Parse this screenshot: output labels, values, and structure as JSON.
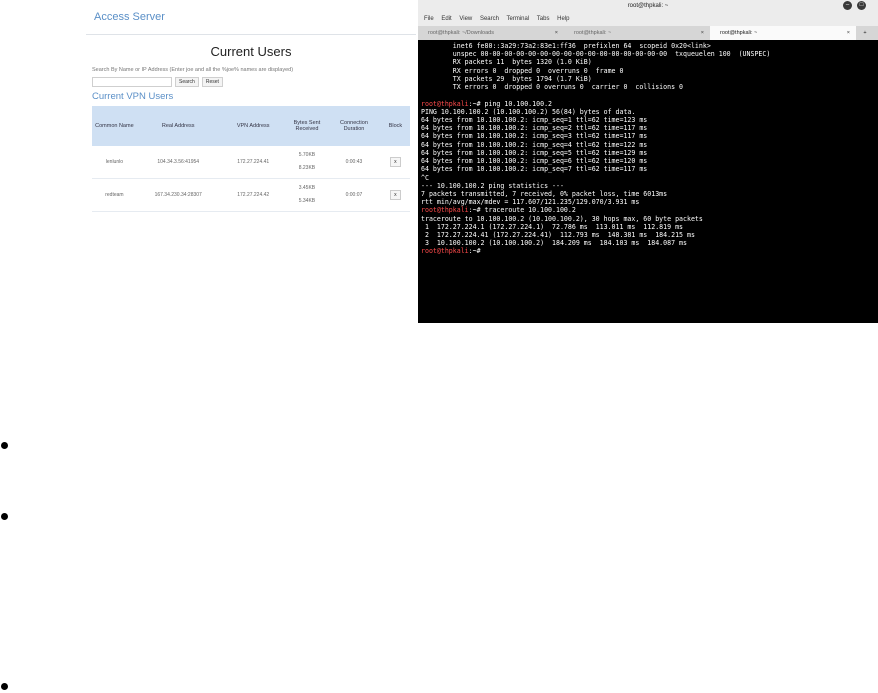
{
  "web": {
    "brand": "Access Server",
    "page_title": "Current Users",
    "search_help": "Search By Name or IP Address (Enter joe and all the %joe% names are displayed)",
    "search_button": "Search",
    "reset_button": "Reset",
    "section_title": "Current VPN Users",
    "columns": [
      "Common Name",
      "Real Address",
      "VPN Address",
      "Bytes Sent Received",
      "Connection Duration",
      "Block"
    ],
    "rows": [
      {
        "name": "lenlunlo",
        "real": "104.34.3.56:41954",
        "vpn": "172.27.224.41",
        "sent": "5.70KB",
        "received": "8.23KB",
        "duration": "0:00:43",
        "block": "x"
      },
      {
        "name": "redteam",
        "real": "167.34.230.34:28307",
        "vpn": "172.27.224.42",
        "sent": "3.45KB",
        "received": "5.34KB",
        "duration": "0:00:07",
        "block": "x"
      }
    ]
  },
  "terminal": {
    "title": "root@thpkali: ~",
    "menu": [
      "File",
      "Edit",
      "View",
      "Search",
      "Terminal",
      "Tabs",
      "Help"
    ],
    "tabs": [
      {
        "label": "root@thpkali: ~/Downloads",
        "active": false
      },
      {
        "label": "root@thpkali: ~",
        "active": false
      },
      {
        "label": "root@thpkali: ~",
        "active": true
      }
    ],
    "tab_close": "×",
    "tab_add": "+",
    "lines": [
      {
        "prompt": "",
        "text": "        inet6 fe80::3a29:73a2:83e1:ff36  prefixlen 64  scopeid 0x20<link>"
      },
      {
        "prompt": "",
        "text": "        unspec 00-00-00-00-00-00-00-00-00-00-00-00-00-00-00-00  txqueuelen 100  (UNSPEC)"
      },
      {
        "prompt": "",
        "text": "        RX packets 11  bytes 1320 (1.0 KiB)"
      },
      {
        "prompt": "",
        "text": "        RX errors 0  dropped 0  overruns 0  frame 0"
      },
      {
        "prompt": "",
        "text": "        TX packets 29  bytes 1794 (1.7 KiB)"
      },
      {
        "prompt": "",
        "text": "        TX errors 0  dropped 0 overruns 0  carrier 0  collisions 0"
      },
      {
        "prompt": "",
        "text": ""
      },
      {
        "prompt": "root@thpkali",
        "text": ":~# ping 10.100.100.2"
      },
      {
        "prompt": "",
        "text": "PING 10.100.100.2 (10.100.100.2) 56(84) bytes of data."
      },
      {
        "prompt": "",
        "text": "64 bytes from 10.100.100.2: icmp_seq=1 ttl=62 time=123 ms"
      },
      {
        "prompt": "",
        "text": "64 bytes from 10.100.100.2: icmp_seq=2 ttl=62 time=117 ms"
      },
      {
        "prompt": "",
        "text": "64 bytes from 10.100.100.2: icmp_seq=3 ttl=62 time=117 ms"
      },
      {
        "prompt": "",
        "text": "64 bytes from 10.100.100.2: icmp_seq=4 ttl=62 time=122 ms"
      },
      {
        "prompt": "",
        "text": "64 bytes from 10.100.100.2: icmp_seq=5 ttl=62 time=129 ms"
      },
      {
        "prompt": "",
        "text": "64 bytes from 10.100.100.2: icmp_seq=6 ttl=62 time=120 ms"
      },
      {
        "prompt": "",
        "text": "64 bytes from 10.100.100.2: icmp_seq=7 ttl=62 time=117 ms"
      },
      {
        "prompt": "",
        "text": "^C"
      },
      {
        "prompt": "",
        "text": "--- 10.100.100.2 ping statistics ---"
      },
      {
        "prompt": "",
        "text": "7 packets transmitted, 7 received, 0% packet loss, time 6013ms"
      },
      {
        "prompt": "",
        "text": "rtt min/avg/max/mdev = 117.607/121.235/129.070/3.931 ms"
      },
      {
        "prompt": "root@thpkali",
        "text": ":~# traceroute 10.100.100.2"
      },
      {
        "prompt": "",
        "text": "traceroute to 10.100.100.2 (10.100.100.2), 30 hops max, 60 byte packets"
      },
      {
        "prompt": "",
        "text": " 1  172.27.224.1 (172.27.224.1)  72.786 ms  113.011 ms  112.819 ms"
      },
      {
        "prompt": "",
        "text": " 2  172.27.224.41 (172.27.224.41)  112.793 ms  148.381 ms  184.215 ms"
      },
      {
        "prompt": "",
        "text": " 3  10.100.100.2 (10.100.100.2)  184.209 ms  184.103 ms  184.087 ms"
      },
      {
        "prompt": "root@thpkali",
        "text": ":~# "
      }
    ]
  }
}
